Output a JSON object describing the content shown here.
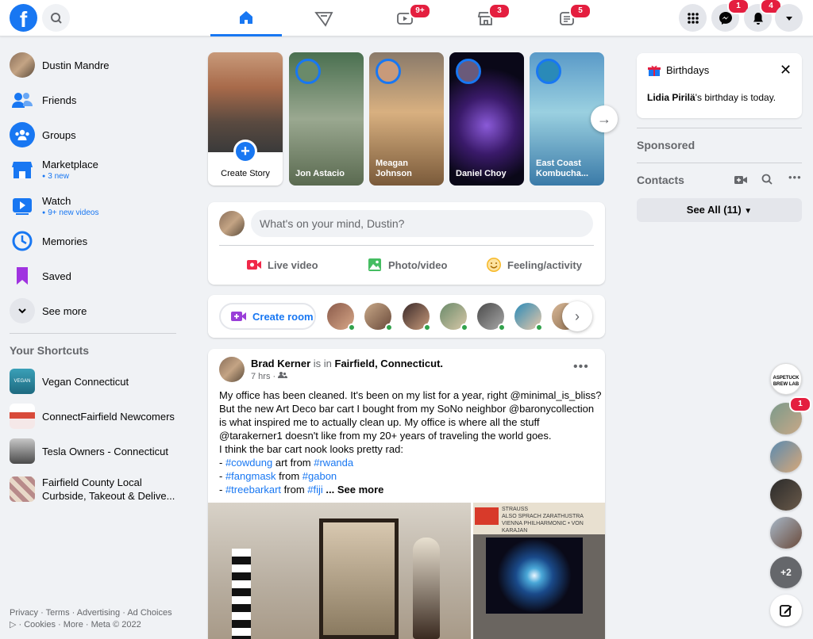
{
  "header": {
    "logo": "f",
    "badges": {
      "watch": "9+",
      "marketplace": "3",
      "gaming": "5",
      "messenger": "1",
      "notifications": "4"
    }
  },
  "sidebar": {
    "items": [
      {
        "label": "Dustin Mandre"
      },
      {
        "label": "Friends"
      },
      {
        "label": "Groups"
      },
      {
        "label": "Marketplace",
        "sub": "3 new"
      },
      {
        "label": "Watch",
        "sub": "9+ new videos"
      },
      {
        "label": "Memories"
      },
      {
        "label": "Saved"
      },
      {
        "label": "See more"
      }
    ],
    "shortcuts_title": "Your Shortcuts",
    "shortcuts": [
      {
        "label": "Vegan Connecticut",
        "thumb_text": "VEGAN"
      },
      {
        "label": "ConnectFairfield Newcomers"
      },
      {
        "label": "Tesla Owners - Connecticut"
      },
      {
        "label": "Fairfield County Local Curbside, Takeout & Delive..."
      }
    ],
    "footer": "Privacy · Terms · Advertising · Ad Choices ▷ · Cookies · More · Meta © 2022"
  },
  "stories": {
    "create_label": "Create Story",
    "items": [
      {
        "name": "Jon Astacio",
        "colors": [
          "#3a5a3a",
          "#8a9a7a"
        ]
      },
      {
        "name": "Meagan Johnson",
        "colors": [
          "#b08a5a",
          "#e8c890"
        ]
      },
      {
        "name": "Daniel Choy",
        "colors": [
          "#1a1030",
          "#6a3aa0"
        ]
      },
      {
        "name": "East Coast Kombucha...",
        "colors": [
          "#2a6a9a",
          "#8ac8d8"
        ]
      }
    ]
  },
  "composer": {
    "placeholder": "What's on your mind, Dustin?",
    "actions": {
      "live": "Live video",
      "photo": "Photo/video",
      "feeling": "Feeling/activity"
    }
  },
  "rooms": {
    "create_label": "Create room"
  },
  "post": {
    "author": "Brad Kerner",
    "is_in": "is in",
    "location": "Fairfield, Connecticut.",
    "time": "7 hrs ·",
    "lines": [
      "My office has been cleaned.   It's been on my list for a year, right @minimal_is_bliss?",
      "But the new Art Deco bar cart I bought from my SoNo neighbor @baronycollection",
      "is what inspired me to actually clean up.  My office is where all the stuff",
      "@tarakerner1 doesn't like from my 20+ years of traveling the world goes.",
      "I think the bar cart nook looks pretty rad:"
    ],
    "tag_lines": [
      {
        "prefix": "- ",
        "tag1": "#cowdung",
        "mid": " art from ",
        "tag2": "#rwanda",
        "suffix": ""
      },
      {
        "prefix": "- ",
        "tag1": "#fangmask",
        "mid": " from ",
        "tag2": "#gabon",
        "suffix": ""
      },
      {
        "prefix": "- ",
        "tag1": "#treebarkart",
        "mid": " from ",
        "tag2": "#fiji",
        "suffix": " ... See more"
      }
    ],
    "album_text": "STRAUSS\nALSO SPRACH ZARATHUSTRA\nVIENNA PHILHARMONIC • VON KARAJAN"
  },
  "right": {
    "birthdays_title": "Birthdays",
    "birthday_name": "Lidia Pirilä",
    "birthday_text": "'s birthday is today.",
    "sponsored": "Sponsored",
    "contacts": "Contacts",
    "see_all": "See All (11)",
    "chat_badge": "1",
    "chat_more": "+2",
    "brewlab": "ASPETUCK BREW LAB"
  }
}
